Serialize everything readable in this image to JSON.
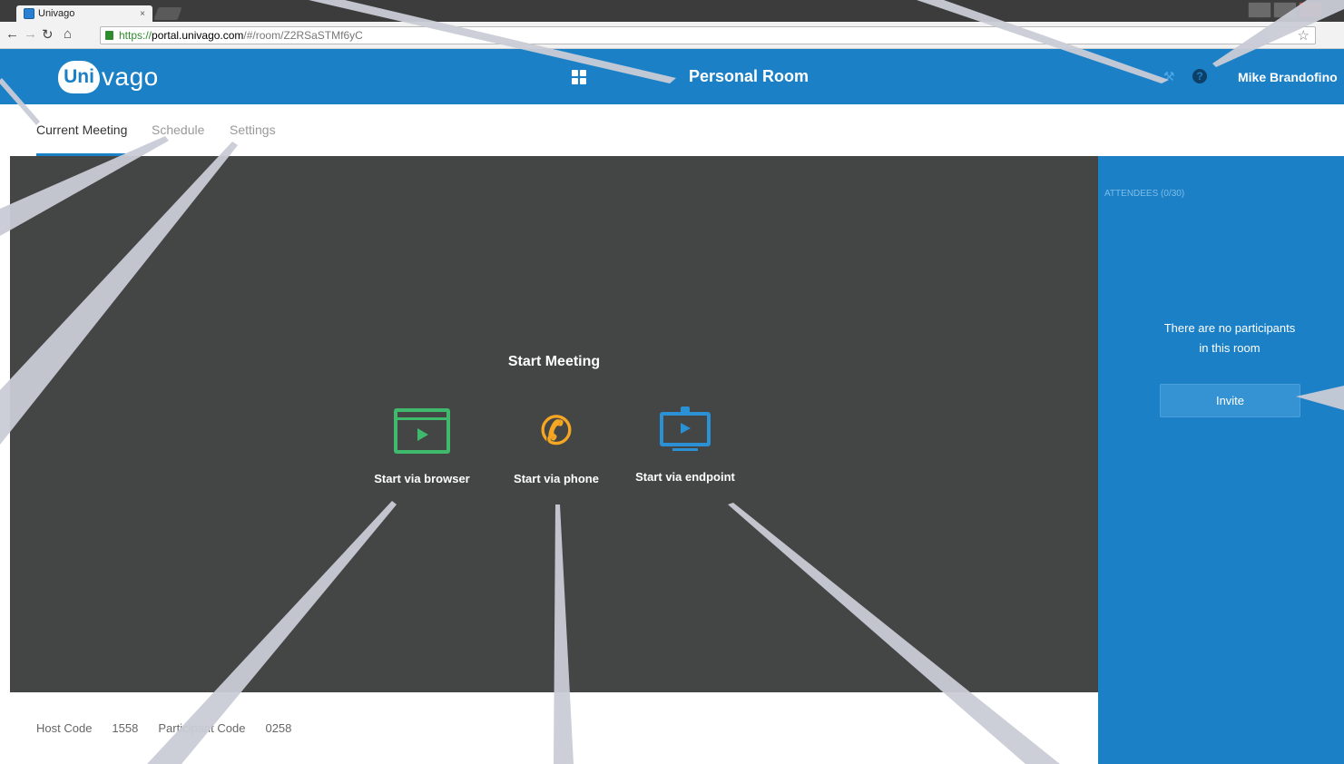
{
  "browser": {
    "tab_title": "Univago",
    "tab_close": "×",
    "url_scheme": "https://",
    "url_host": "portal.univago.com",
    "url_path": "/#/room/Z2RSaSTMf6yC"
  },
  "header": {
    "logo_part1": "Uni",
    "logo_part2": "vago",
    "page_title": "Personal Room",
    "user_name": "Mike Brandofino",
    "icons": [
      "apps-icon",
      "tools-icon",
      "help-icon"
    ]
  },
  "tabs": [
    {
      "label": "Current Meeting",
      "active": true
    },
    {
      "label": "Schedule",
      "active": false
    },
    {
      "label": "Settings",
      "active": false
    }
  ],
  "stage": {
    "title": "Start Meeting",
    "options": [
      {
        "label": "Start via browser",
        "icon": "browser-icon",
        "color": "#3fb96b"
      },
      {
        "label": "Start via phone",
        "icon": "phone-icon",
        "color": "#f5a623"
      },
      {
        "label": "Start via endpoint",
        "icon": "endpoint-icon",
        "color": "#2b90d4"
      }
    ]
  },
  "codes": {
    "host_label": "Host Code",
    "host_value": "1558",
    "participant_label": "Participant Code",
    "participant_value": "0258"
  },
  "sidebar": {
    "attendees_title": "ATTENDEES (0/30)",
    "empty_line1": "There are no participants",
    "empty_line2": "in this room",
    "invite_label": "Invite"
  },
  "colors": {
    "brand": "#1b80c6",
    "stage_bg": "#444545"
  }
}
